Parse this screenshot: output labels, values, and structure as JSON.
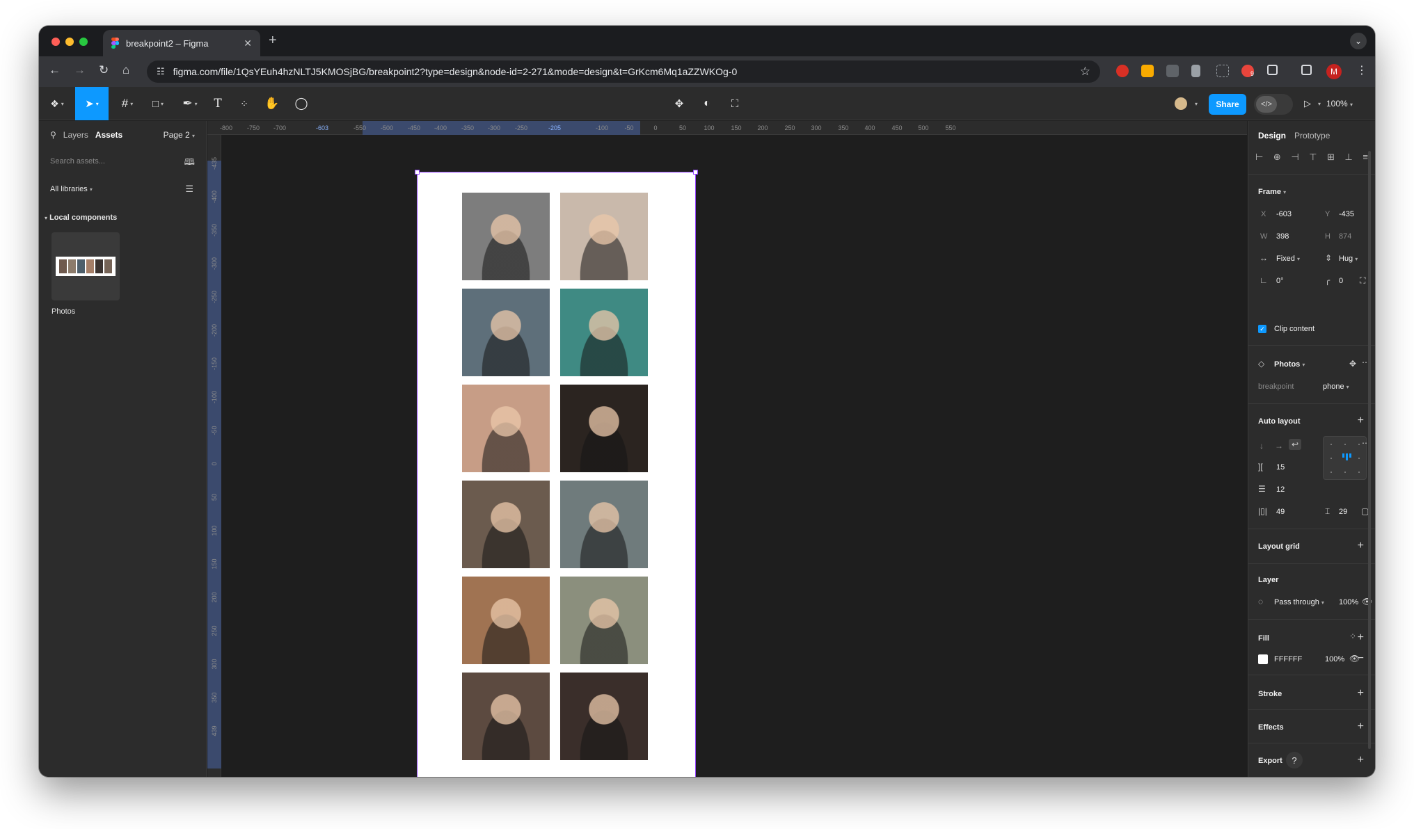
{
  "browser": {
    "tab_title": "breakpoint2 – Figma",
    "new_tab": "+",
    "url": "figma.com/file/1QsYEuh4hzNLTJ5KMOSjBG/breakpoint2?type=design&node-id=2-271&mode=design&t=GrKcm6Mq1aZZWKOg-0",
    "profile_initial": "M",
    "extension_badge": "9"
  },
  "toolbar": {
    "share_label": "Share",
    "zoom": "100%",
    "text_tool": "T"
  },
  "left_panel": {
    "tabs": [
      "Layers",
      "Assets"
    ],
    "active_tab": "Assets",
    "page": "Page 2",
    "search_placeholder": "Search assets...",
    "libraries": "All libraries",
    "section": "Local components",
    "component_name": "Photos"
  },
  "canvas": {
    "ruler_top_ticks": [
      "-800",
      "-750",
      "-700",
      "-603",
      "-550",
      "-500",
      "-450",
      "-400",
      "-350",
      "-300",
      "-250",
      "-205",
      "-100",
      "-50",
      "0",
      "50",
      "100",
      "150",
      "200",
      "250",
      "300",
      "350",
      "400",
      "450",
      "500",
      "550"
    ],
    "ruler_left_ticks": [
      "-435",
      "-400",
      "-350",
      "-300",
      "-250",
      "-200",
      "-150",
      "-100",
      "-50",
      "0",
      "50",
      "100",
      "150",
      "200",
      "250",
      "300",
      "350",
      "439"
    ],
    "frame_background": "#ffffff",
    "photo_colors": [
      "#7d7d7d",
      "#c9b9ab",
      "#5e6f7a",
      "#3f8a83",
      "#c79d86",
      "#2b2420",
      "#6b5b4e",
      "#6f7b7c",
      "#a07352",
      "#8b8f7d",
      "#5c4a40",
      "#3a2e2a"
    ]
  },
  "right_panel": {
    "tabs": [
      "Design",
      "Prototype"
    ],
    "active_tab": "Design",
    "frame": {
      "title": "Frame",
      "x_label": "X",
      "x": "-603",
      "y_label": "Y",
      "y": "-435",
      "w_label": "W",
      "w": "398",
      "h_label": "H",
      "h": "874",
      "width_mode": "Fixed",
      "height_mode": "Hug",
      "rotation": "0°",
      "radius": "0",
      "clip_content": "Clip content"
    },
    "component": {
      "name": "Photos",
      "property": "breakpoint",
      "value": "phone"
    },
    "auto_layout": {
      "title": "Auto layout",
      "gap": "15",
      "row_gap": "12",
      "padding_h": "49",
      "padding_v": "29"
    },
    "layout_grid": "Layout grid",
    "layer": {
      "title": "Layer",
      "blend": "Pass through",
      "opacity": "100%"
    },
    "fill": {
      "title": "Fill",
      "color": "FFFFFF",
      "opacity": "100%"
    },
    "stroke": "Stroke",
    "effects": "Effects",
    "export": "Export",
    "help": "?"
  },
  "colors": {
    "accent": "#0d99ff",
    "selection": "#9747ff",
    "annotation_arrow": "#e8141c"
  }
}
